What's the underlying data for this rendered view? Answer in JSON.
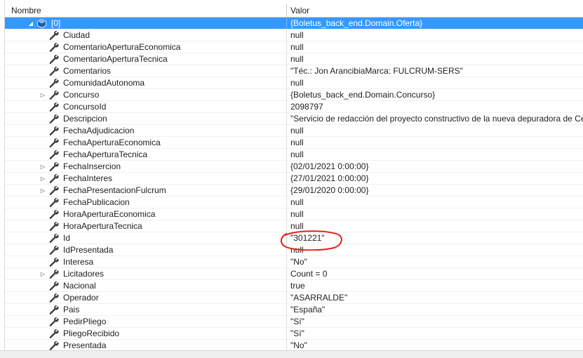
{
  "header": {
    "name_label": "Nombre",
    "value_label": "Valor"
  },
  "colors": {
    "selection": "#3399ff",
    "annotation": "#e8201a"
  },
  "rows": [
    {
      "name": "[0]",
      "value": "{Boletus_back_end.Domain.Oferta}",
      "expander": "collapse",
      "icon": "object-icon",
      "selected": true
    },
    {
      "name": "Ciudad",
      "value": "null",
      "expander": "",
      "icon": "wrench-icon"
    },
    {
      "name": "ComentarioAperturaEconomica",
      "value": "null",
      "expander": "",
      "icon": "wrench-icon"
    },
    {
      "name": "ComentarioAperturaTecnica",
      "value": "null",
      "expander": "",
      "icon": "wrench-icon"
    },
    {
      "name": "Comentarios",
      "value": "\"Téc.: Jon ArancibiaMarca: FULCRUM-SERS\"",
      "expander": "",
      "icon": "wrench-icon"
    },
    {
      "name": "ComunidadAutonoma",
      "value": "null",
      "expander": "",
      "icon": "wrench-icon"
    },
    {
      "name": "Concurso",
      "value": "{Boletus_back_end.Domain.Concurso}",
      "expander": "expand",
      "icon": "wrench-icon"
    },
    {
      "name": "ConcursoId",
      "value": "2098797",
      "expander": "",
      "icon": "wrench-icon"
    },
    {
      "name": "Descripcion",
      "value": "\"Servicio de redacción del proyecto constructivo de la nueva depuradora de Cee",
      "expander": "",
      "icon": "wrench-icon"
    },
    {
      "name": "FechaAdjudicacion",
      "value": "null",
      "expander": "",
      "icon": "wrench-icon"
    },
    {
      "name": "FechaAperturaEconomica",
      "value": "null",
      "expander": "",
      "icon": "wrench-icon"
    },
    {
      "name": "FechaAperturaTecnica",
      "value": "null",
      "expander": "",
      "icon": "wrench-icon"
    },
    {
      "name": "FechaInsercion",
      "value": "{02/01/2021 0:00:00}",
      "expander": "expand",
      "icon": "wrench-icon"
    },
    {
      "name": "FechaInteres",
      "value": "{27/01/2021 0:00:00}",
      "expander": "expand",
      "icon": "wrench-icon"
    },
    {
      "name": "FechaPresentacionFulcrum",
      "value": "{29/01/2020 0:00:00}",
      "expander": "expand",
      "icon": "wrench-icon"
    },
    {
      "name": "FechaPublicacion",
      "value": "null",
      "expander": "",
      "icon": "wrench-icon"
    },
    {
      "name": "HoraAperturaEconomica",
      "value": "null",
      "expander": "",
      "icon": "wrench-icon"
    },
    {
      "name": "HoraAperturaTecnica",
      "value": "null",
      "expander": "",
      "icon": "wrench-icon"
    },
    {
      "name": "Id",
      "value": "\"301221\"",
      "expander": "",
      "icon": "wrench-icon",
      "circled": true
    },
    {
      "name": "IdPresentada",
      "value": "null",
      "expander": "",
      "icon": "wrench-icon"
    },
    {
      "name": "Interesa",
      "value": "\"No\"",
      "expander": "",
      "icon": "wrench-icon"
    },
    {
      "name": "Licitadores",
      "value": "Count = 0",
      "expander": "expand",
      "icon": "wrench-icon"
    },
    {
      "name": "Nacional",
      "value": "true",
      "expander": "",
      "icon": "wrench-icon"
    },
    {
      "name": "Operador",
      "value": "\"ASARRALDE\"",
      "expander": "",
      "icon": "wrench-icon"
    },
    {
      "name": "Pais",
      "value": "\"España\"",
      "expander": "",
      "icon": "wrench-icon"
    },
    {
      "name": "PedirPliego",
      "value": "\"Sí\"",
      "expander": "",
      "icon": "wrench-icon"
    },
    {
      "name": "PliegoRecibido",
      "value": "\"Sí\"",
      "expander": "",
      "icon": "wrench-icon"
    },
    {
      "name": "Presentada",
      "value": "\"No\"",
      "expander": "",
      "icon": "wrench-icon"
    }
  ]
}
